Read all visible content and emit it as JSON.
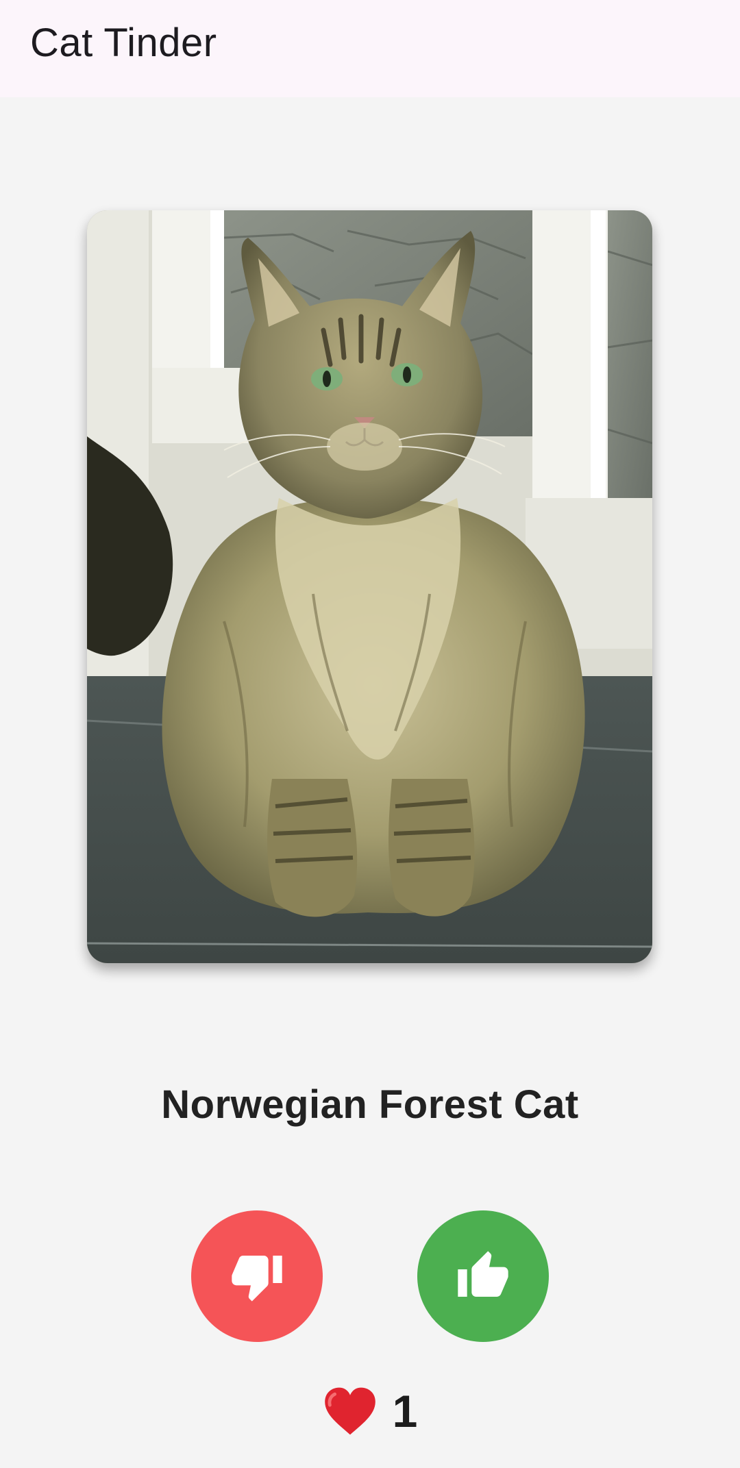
{
  "app_bar": {
    "title": "Cat Tinder"
  },
  "cat": {
    "name": "Norwegian Forest Cat"
  },
  "actions": {
    "dislike": {
      "icon": "thumb-down-icon",
      "color": "#f55457"
    },
    "like": {
      "icon": "thumb-up-icon",
      "color": "#4caf50"
    }
  },
  "likes": {
    "icon": "heart-icon",
    "count": "1"
  },
  "colors": {
    "app_bar_bg": "#fcf5fb",
    "page_bg": "#f4f4f4",
    "heart": "#e0242f"
  }
}
